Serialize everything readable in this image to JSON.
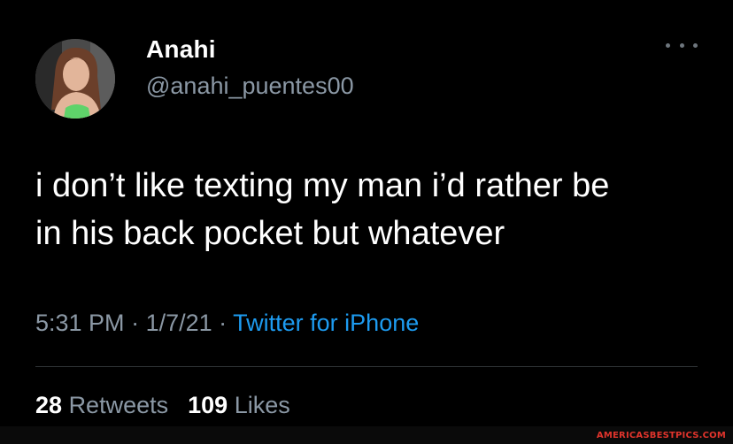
{
  "author": {
    "display_name": "Anahi",
    "handle": "@anahi_puentes00",
    "avatar_icon": "profile-photo"
  },
  "tweet": {
    "text": "i don’t like texting my man i’d rather be\nin his back pocket but whatever",
    "time": "5:31 PM",
    "separator": " · ",
    "date": "1/7/21",
    "source": "Twitter for iPhone"
  },
  "stats": {
    "retweets_count": "28",
    "retweets_label": "Retweets",
    "likes_count": "109",
    "likes_label": "Likes"
  },
  "menu": {
    "icon": "more-horizontal-icon"
  },
  "watermark": {
    "text": "AMERICASBESTPICS.COM"
  },
  "colors": {
    "background": "#000000",
    "text": "#ffffff",
    "secondary": "#8b98a5",
    "link": "#1d9bf0",
    "divider": "#2f3336",
    "watermark": "#e0342c"
  }
}
